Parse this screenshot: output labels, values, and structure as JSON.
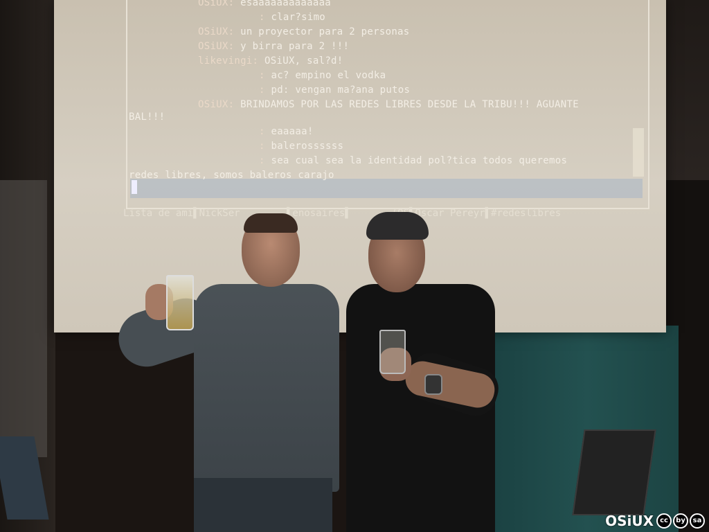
{
  "screen": {
    "chat_lines": [
      {
        "nick": "OSiUX:",
        "message": "esaaaaaaaaaaaaa"
      },
      {
        "nick": ":",
        "message": "clar?simo"
      },
      {
        "nick": "OSiUX:",
        "message": "un proyector para 2 personas"
      },
      {
        "nick": "OSiUX:",
        "message": "y birra para 2 !!!"
      },
      {
        "nick": "likevingi:",
        "message": "OSiUX, sal?d!"
      },
      {
        "nick": ":",
        "message": "ac? empino el vodka"
      },
      {
        "nick": ":",
        "message": "pd: vengan ma?ana putos"
      },
      {
        "nick": "OSiUX:",
        "message": "BRINDAMOS POR LAS REDES LIBRES DESDE LA TRIBU!!! AGUANTE"
      },
      {
        "nick": "",
        "message": "BAL!!!"
      },
      {
        "nick": ":",
        "message": "eaaaaa!"
      },
      {
        "nick": ":",
        "message": "balerossssss"
      },
      {
        "nick": ":",
        "message": "sea cual sea la identidad pol?tica todos queremos"
      },
      {
        "nick": "",
        "message": "redes libres, somos baleros carajo"
      }
    ],
    "status_items": [
      "Lista de ami",
      "NickServ",
      "",
      "Oscar Pereyra",
      "#redeslibres"
    ],
    "status_text": "Lista de ami▌NickSer        ▌enosaires▌       (OS▌Oscar Pereyr▌#redeslibres"
  },
  "watermark": {
    "text": "OSiUX",
    "license_icons": [
      "cc",
      "by",
      "sa"
    ]
  },
  "colors": {
    "screen": "#d2cabd",
    "terminal_text": "#f3eee5",
    "teal_wall": "#235150"
  }
}
